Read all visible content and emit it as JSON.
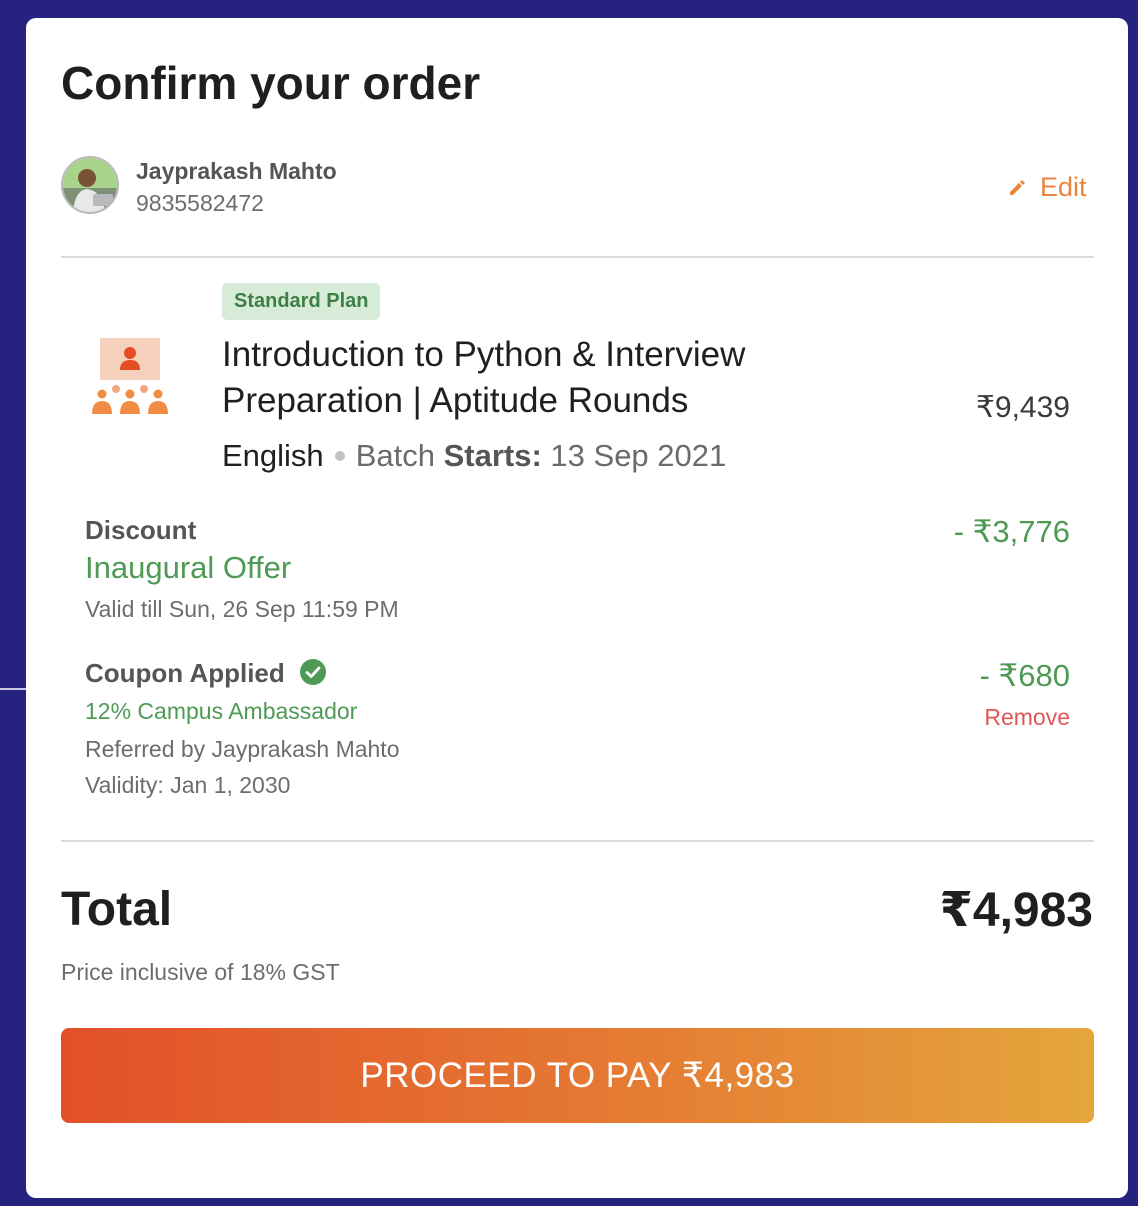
{
  "page": {
    "title": "Confirm your order"
  },
  "user": {
    "name": "Jayprakash Mahto",
    "phone": "9835582472",
    "edit_label": "Edit"
  },
  "course": {
    "plan_badge": "Standard Plan",
    "title": "Introduction to Python & Interview Preparation | Aptitude Rounds",
    "language": "English",
    "batch_prefix": "Batch",
    "batch_label": "Starts:",
    "batch_date": "13 Sep 2021",
    "price": "₹9,439"
  },
  "discount": {
    "label": "Discount",
    "offer": "Inaugural Offer",
    "validity": "Valid till Sun, 26 Sep 11:59 PM",
    "amount": "- ₹3,776"
  },
  "coupon": {
    "label": "Coupon Applied",
    "name": "12% Campus Ambassador",
    "referred_by": "Referred by Jayprakash Mahto",
    "validity": "Validity: Jan 1, 2030",
    "amount": "- ₹680",
    "remove_label": "Remove"
  },
  "total": {
    "label": "Total",
    "value": "₹4,983",
    "gst_note": "Price inclusive of 18% GST"
  },
  "pay_button": {
    "label": "PROCEED TO PAY ₹4,983"
  },
  "colors": {
    "background": "#262380",
    "accent_orange": "#e8853c",
    "green": "#4e9a55",
    "red": "#e05656",
    "badge_bg": "#d7ecd8"
  }
}
